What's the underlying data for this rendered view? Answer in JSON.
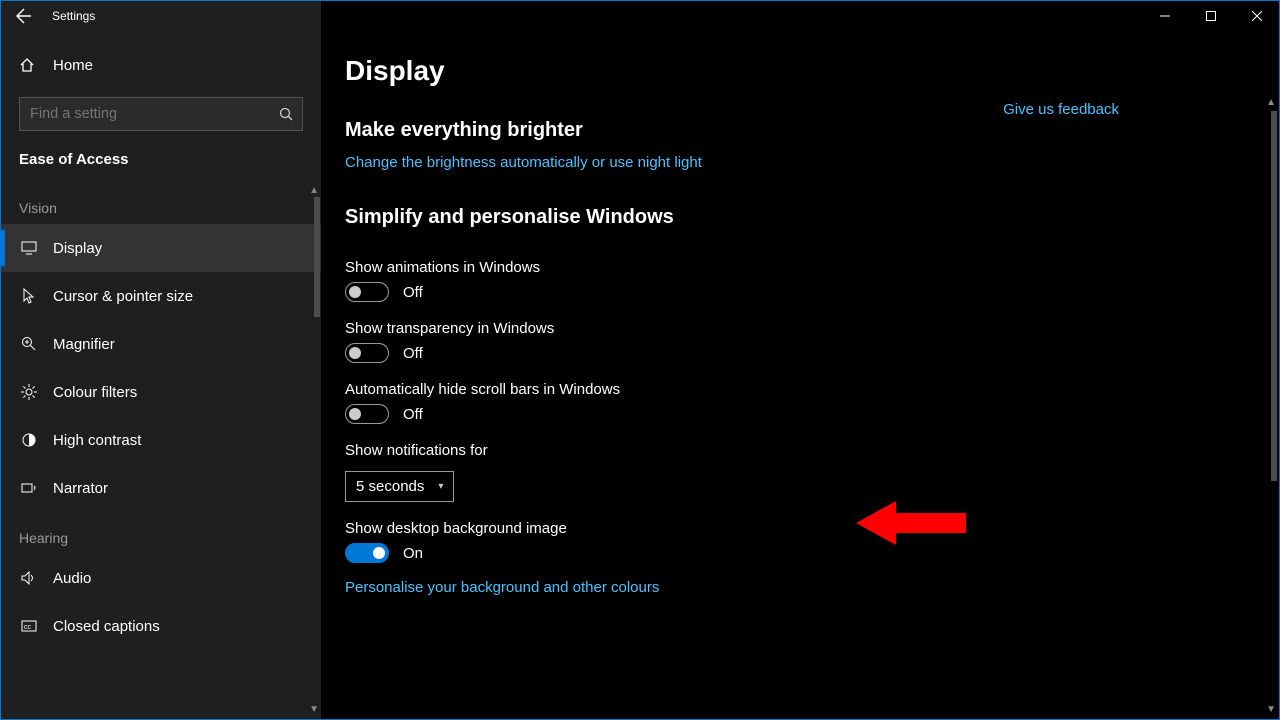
{
  "window": {
    "title": "Settings"
  },
  "sidebar": {
    "home": "Home",
    "search_placeholder": "Find a setting",
    "category": "Ease of Access",
    "groups": {
      "vision": "Vision",
      "hearing": "Hearing"
    },
    "items": [
      {
        "label": "Display"
      },
      {
        "label": "Cursor & pointer size"
      },
      {
        "label": "Magnifier"
      },
      {
        "label": "Colour filters"
      },
      {
        "label": "High contrast"
      },
      {
        "label": "Narrator"
      },
      {
        "label": "Audio"
      },
      {
        "label": "Closed captions"
      }
    ]
  },
  "main": {
    "title": "Display",
    "feedback": "Give us feedback",
    "section1": {
      "title": "Make everything brighter",
      "link": "Change the brightness automatically or use night light"
    },
    "section2": {
      "title": "Simplify and personalise Windows",
      "animations": {
        "label": "Show animations in Windows",
        "state": "Off"
      },
      "transparency": {
        "label": "Show transparency in Windows",
        "state": "Off"
      },
      "scrollbars": {
        "label": "Automatically hide scroll bars in Windows",
        "state": "Off"
      },
      "notifications": {
        "label": "Show notifications for",
        "value": "5 seconds"
      },
      "desktopbg": {
        "label": "Show desktop background image",
        "state": "On"
      },
      "personalise_link": "Personalise your background and other colours"
    }
  }
}
